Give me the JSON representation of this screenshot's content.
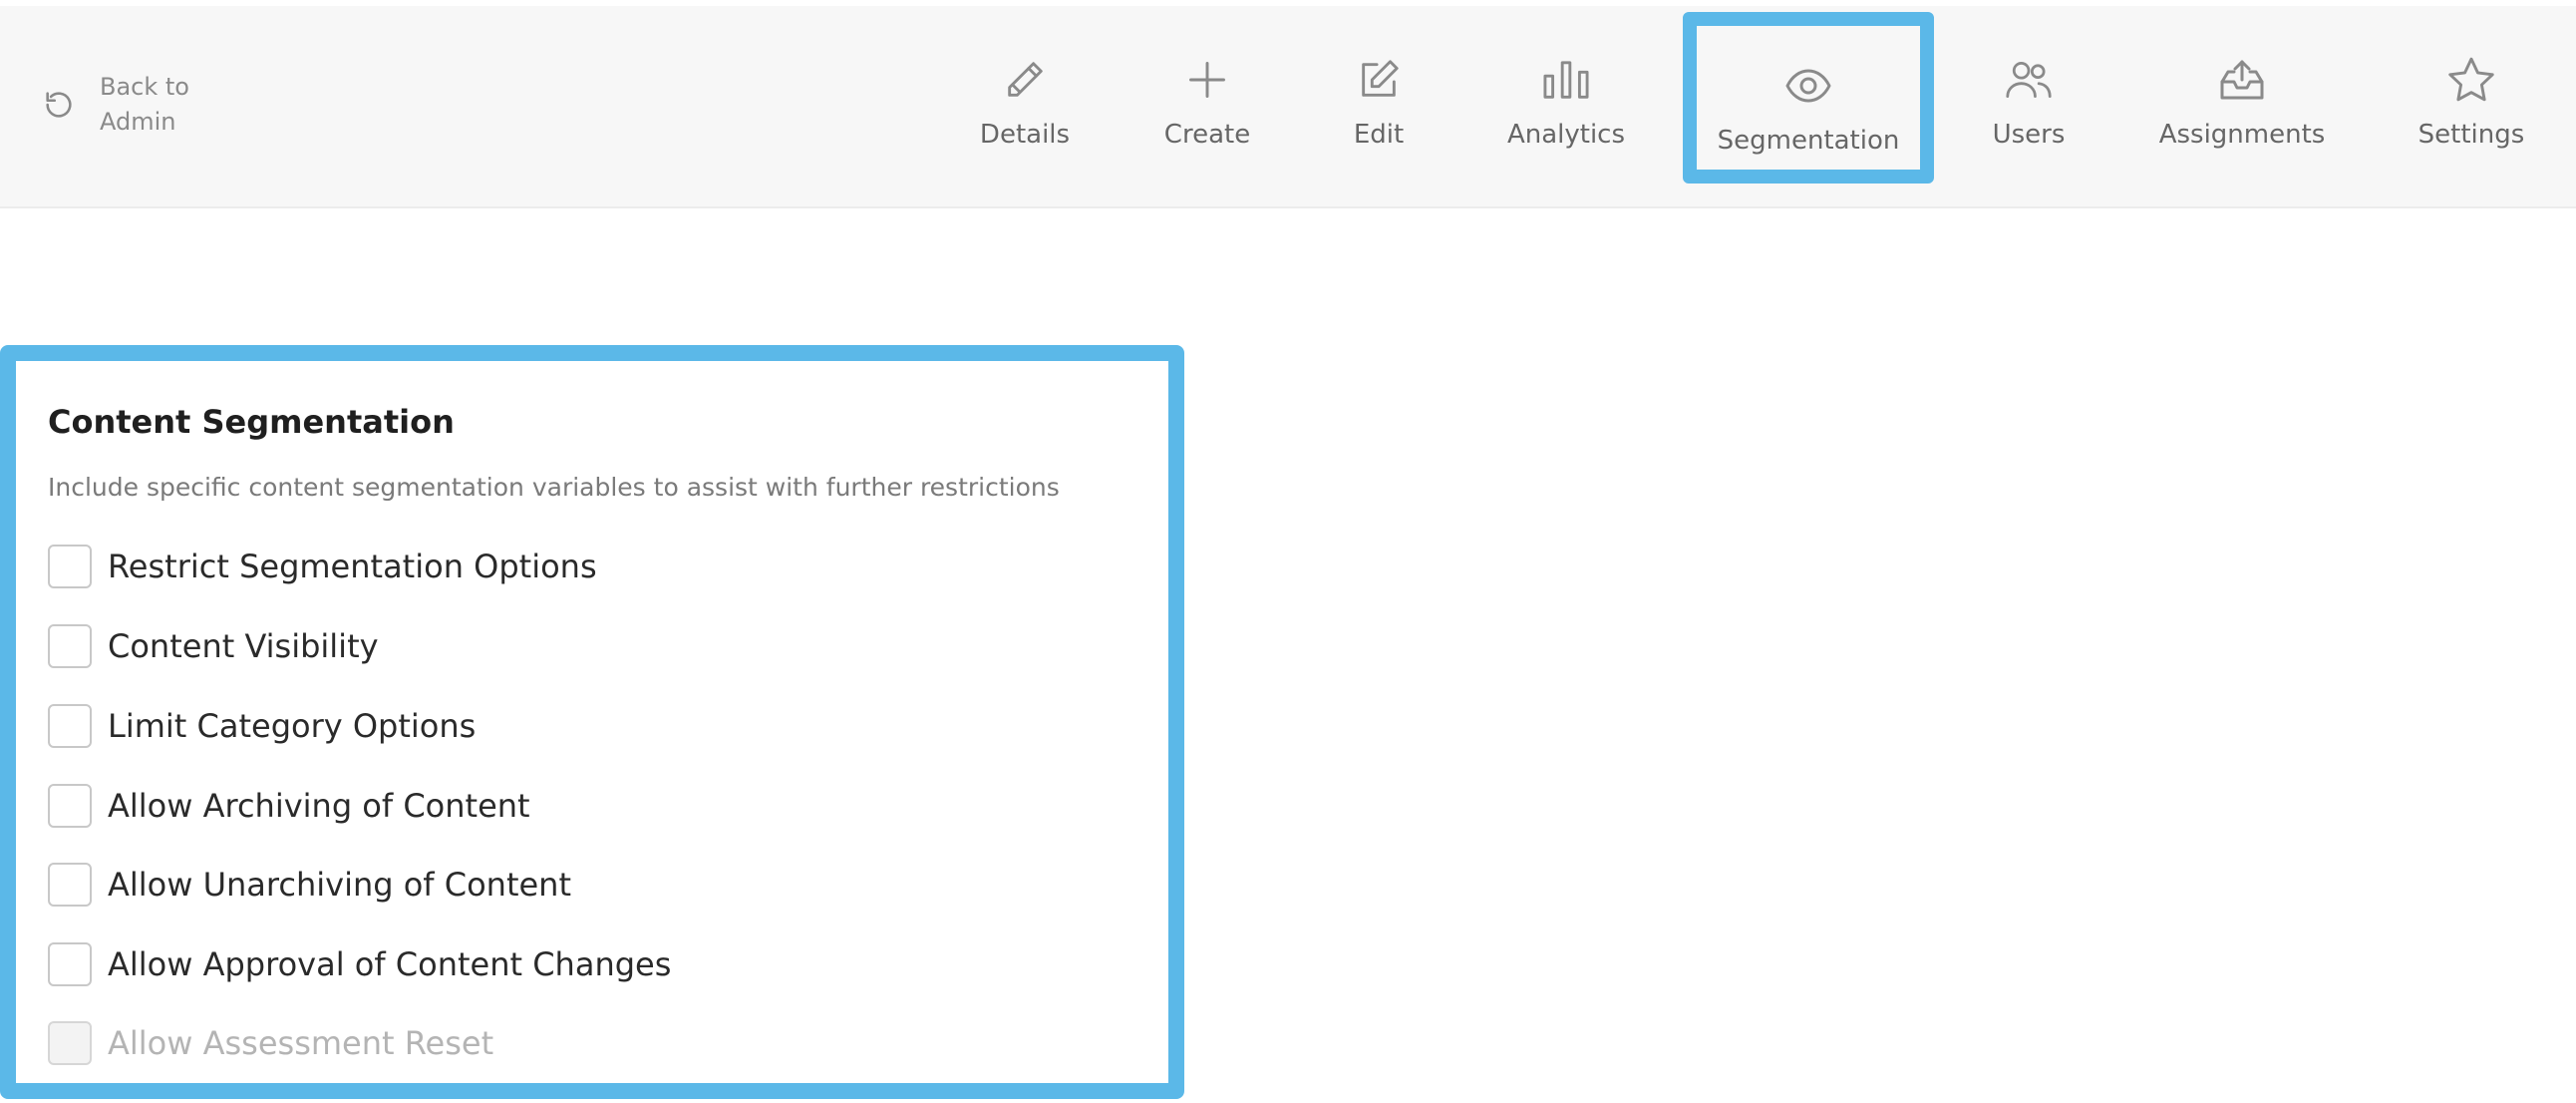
{
  "header": {
    "back_label": "Back to Admin",
    "nav": [
      {
        "label": "Details",
        "icon": "pencil-icon"
      },
      {
        "label": "Create",
        "icon": "plus-icon"
      },
      {
        "label": "Edit",
        "icon": "edit-square-icon"
      },
      {
        "label": "Analytics",
        "icon": "bar-chart-icon"
      },
      {
        "label": "Segmentation",
        "icon": "eye-icon",
        "active": true
      },
      {
        "label": "Users",
        "icon": "users-icon"
      },
      {
        "label": "Assignments",
        "icon": "inbox-upload-icon"
      },
      {
        "label": "Settings",
        "icon": "star-icon"
      }
    ]
  },
  "segmentation": {
    "title": "Content Segmentation",
    "description": "Include specific content segmentation variables to assist with further restrictions",
    "options": [
      {
        "label": "Restrict Segmentation Options",
        "checked": false,
        "disabled": false
      },
      {
        "label": "Content Visibility",
        "checked": false,
        "disabled": false
      },
      {
        "label": "Limit Category Options",
        "checked": false,
        "disabled": false
      },
      {
        "label": "Allow Archiving of Content",
        "checked": false,
        "disabled": false
      },
      {
        "label": "Allow Unarchiving of Content",
        "checked": false,
        "disabled": false
      },
      {
        "label": "Allow Approval of Content Changes",
        "checked": false,
        "disabled": false
      },
      {
        "label": "Allow Assessment Reset",
        "checked": false,
        "disabled": true
      }
    ]
  },
  "colors": {
    "highlight": "#5bb8e8",
    "icon": "#8a8a8a",
    "topbar_bg": "#f7f7f7"
  }
}
